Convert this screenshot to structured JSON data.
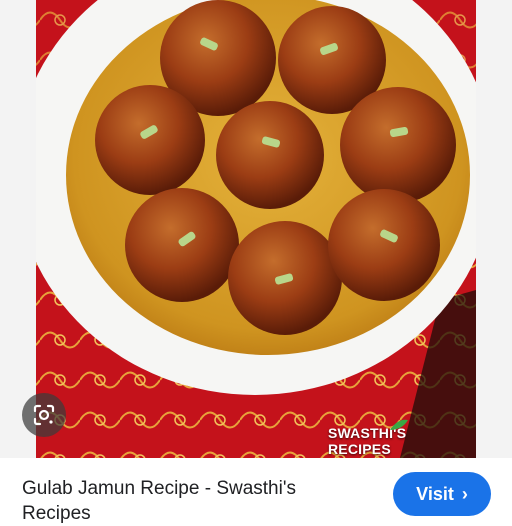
{
  "image": {
    "alt": "",
    "watermark": "SWASTHI'S RECIPES"
  },
  "lens": {
    "icon": "google-lens-icon"
  },
  "result": {
    "title": "Gulab Jamun Recipe - Swasthi's Recipes"
  },
  "visit": {
    "label": "Visit",
    "icon": "chevron-right-icon"
  },
  "colors": {
    "accent": "#1a73e8",
    "text": "#202124",
    "syrup": "#d9a21f",
    "jamun": "#9c3d14",
    "cloth": "#c4121b"
  }
}
